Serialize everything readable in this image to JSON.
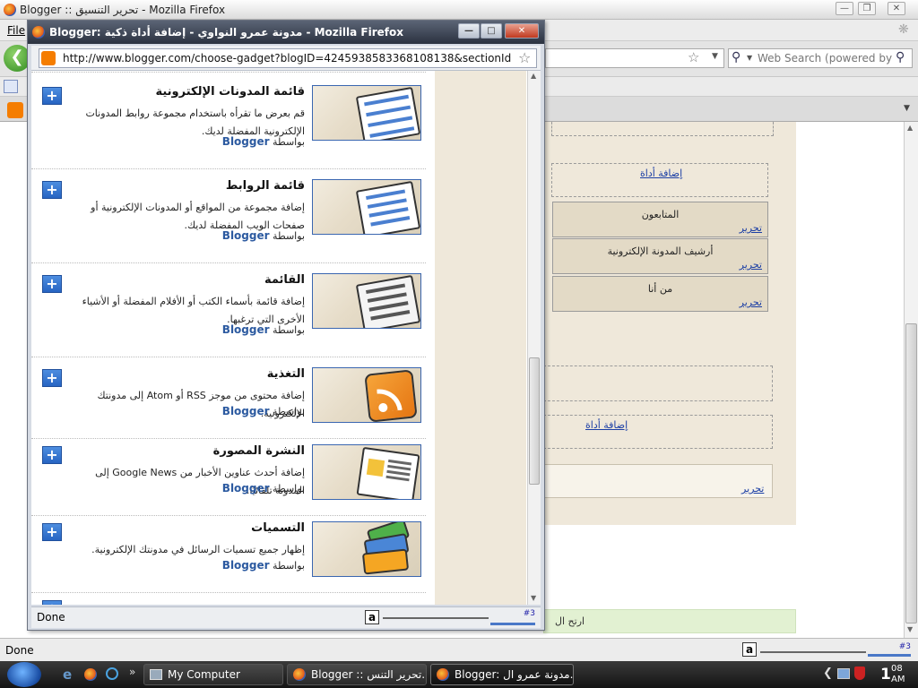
{
  "main_window": {
    "title": "Blogger :: تحرير التنسيق - Mozilla Firefox",
    "menu_file": "File",
    "search_placeholder": "Web Search (powered by Go",
    "panel": {
      "add_gadget_1": "إضافة أداة",
      "gadgets": [
        {
          "label": "المتابعون",
          "edit": "تحرير"
        },
        {
          "label": "أرشيف المدونة الإلكترونية",
          "edit": "تحرير"
        },
        {
          "label": "من أنا",
          "edit": "تحرير"
        }
      ],
      "add_gadget_2": "إضافة أداة",
      "footer_edit": "تحرير"
    },
    "green_strip_text": "ارتح ال",
    "status": "Done",
    "status_counter": "#3"
  },
  "popup": {
    "title": "Blogger: مدونة عمرو النواوي - إضافة أداة ذكية - Mozilla Firefox",
    "url": "http://www.blogger.com/choose-gadget?blogID=4245938583368108138&sectionId=footer-1",
    "status": "Done",
    "status_counter": "#3",
    "by_label": "بواسطة",
    "items": [
      {
        "title": "قائمة المدونات الإلكترونية",
        "description": "قم بعرض ما تقرأه باستخدام مجموعة روابط المدونات الإلكترونية المفضلة لديك.",
        "author": "Blogger",
        "icon": "blog-list-icon"
      },
      {
        "title": "قائمة الروابط",
        "description": "إضافة مجموعة من المواقع أو المدونات الإلكترونية أو صفحات الويب المفضلة لديك.",
        "author": "Blogger",
        "icon": "link-list-icon"
      },
      {
        "title": "القائمة",
        "description": "إضافة قائمة بأسماء الكتب أو الأفلام المفضلة أو الأشياء الأخرى التي ترغبها.",
        "author": "Blogger",
        "icon": "list-icon"
      },
      {
        "title": "التغذية",
        "description": "إضافة محتوى من موجز RSS أو Atom إلى مدونتك الإلكترونية.",
        "author": "Blogger",
        "icon": "rss-feed-icon"
      },
      {
        "title": "النشرة المصورة",
        "description": "إضافة أحدث عناوين الأخبار من Google News إلى المدونة تلقائيًا.",
        "author": "Blogger",
        "icon": "newsreel-icon"
      },
      {
        "title": "التسميات",
        "description": "إظهار جميع تسميات الرسائل في مدونتك الإلكترونية.",
        "author": "Blogger",
        "icon": "labels-icon"
      }
    ]
  },
  "taskbar": {
    "buttons": [
      "My Computer",
      "Blogger :: تحرير التنس...",
      "Blogger: مدونة عمرو ال..."
    ],
    "clock_hour": "08",
    "clock_ampm": "AM",
    "clock_prefix": "1"
  }
}
